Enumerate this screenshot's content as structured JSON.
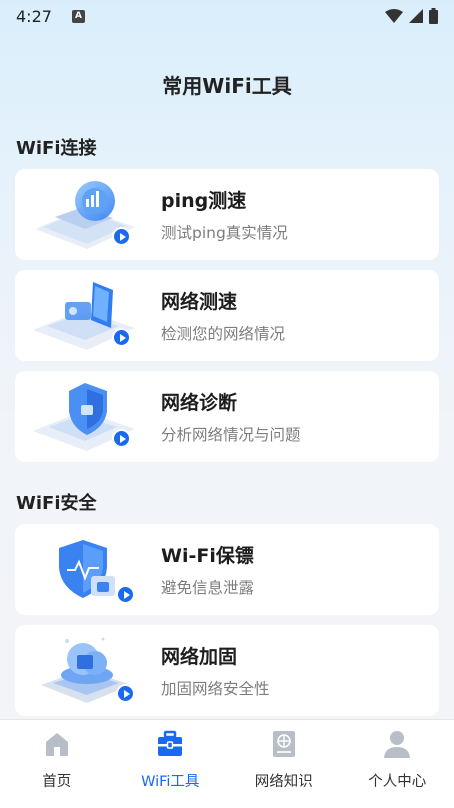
{
  "status_bar": {
    "time": "4:27",
    "notification_icon": "a-badge-icon",
    "icons": [
      "wifi-icon",
      "signal-icon",
      "battery-icon"
    ]
  },
  "header": {
    "title": "常用WiFi工具"
  },
  "sections": [
    {
      "title": "WiFi连接",
      "items": [
        {
          "title": "ping测速",
          "subtitle": "测试ping真实情况",
          "icon": "ping-speed-icon"
        },
        {
          "title": "网络测速",
          "subtitle": "检测您的网络情况",
          "icon": "phone-speed-icon"
        },
        {
          "title": "网络诊断",
          "subtitle": "分析网络情况与问题",
          "icon": "shield-diagnose-icon"
        }
      ]
    },
    {
      "title": "WiFi安全",
      "items": [
        {
          "title": "Wi-Fi保镖",
          "subtitle": "避免信息泄露",
          "icon": "shield-lock-icon"
        },
        {
          "title": "网络加固",
          "subtitle": "加固网络安全性",
          "icon": "cloud-lock-icon"
        }
      ]
    }
  ],
  "tabbar": {
    "active_index": 1,
    "tabs": [
      {
        "label": "首页",
        "icon": "home-icon"
      },
      {
        "label": "WiFi工具",
        "icon": "toolbox-icon"
      },
      {
        "label": "网络知识",
        "icon": "book-icon"
      },
      {
        "label": "个人中心",
        "icon": "person-icon"
      }
    ]
  },
  "colors": {
    "accent": "#1a6af1",
    "inactive_icon": "#b8bec7",
    "subtitle": "#7d7d7d"
  }
}
